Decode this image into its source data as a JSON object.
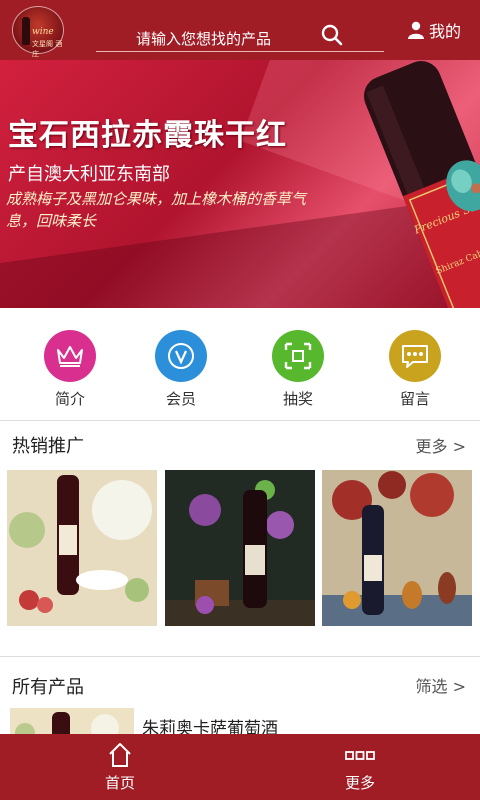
{
  "header": {
    "logo_text": "wine",
    "logo_sub": "文星阁 酒庄",
    "search_placeholder": "请输入您想找的产品",
    "me_label": "我的",
    "colors": {
      "brand": "#a01d26"
    }
  },
  "banner": {
    "title": "宝石西拉赤霞珠干红",
    "subtitle": "产自澳大利亚东南部",
    "description": "成熟梅子及黑加仑果味，加上橡木桶的香草气息，回味柔长",
    "label_brand": "Precious Stone",
    "label_variety": "Shiraz Cabernet"
  },
  "categories": [
    {
      "label": "简介",
      "icon": "crown-icon",
      "color": "#d9308f"
    },
    {
      "label": "会员",
      "icon": "member-v-icon",
      "color": "#2b8fd9"
    },
    {
      "label": "抽奖",
      "icon": "lottery-arrows-icon",
      "color": "#58b82d"
    },
    {
      "label": "留言",
      "icon": "message-bubble-icon",
      "color": "#c9a21e"
    }
  ],
  "hot_section": {
    "title": "热销推广",
    "more": "更多 >"
  },
  "all_section": {
    "title": "所有产品",
    "filter": "筛选 >"
  },
  "products": [
    {
      "name": "朱莉奥卡萨葡萄酒"
    }
  ],
  "nav": [
    {
      "label": "首页",
      "icon": "home-icon"
    },
    {
      "label": "更多",
      "icon": "more-dots-icon"
    }
  ]
}
